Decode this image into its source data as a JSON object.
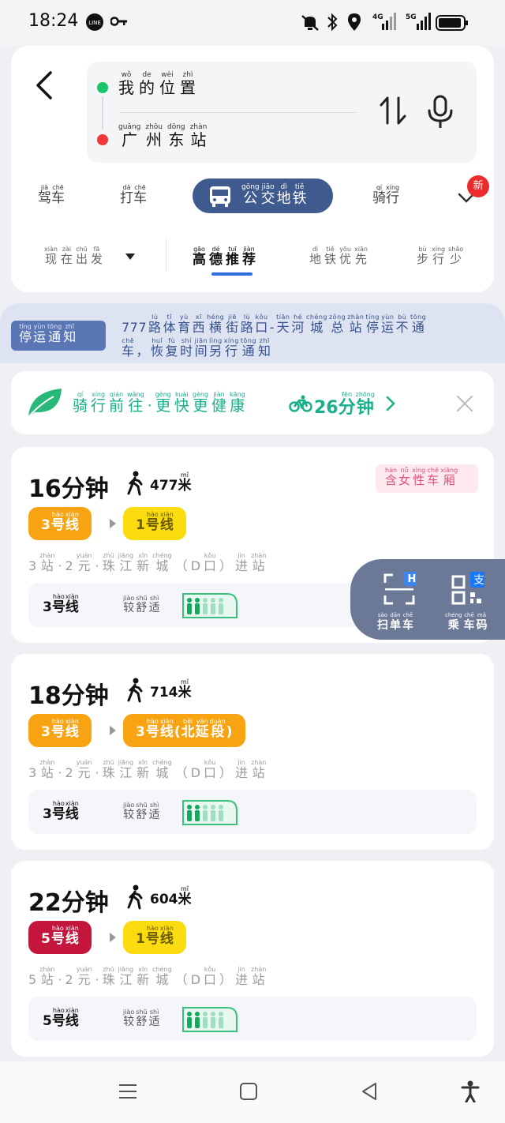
{
  "status_bar": {
    "time": "18:24",
    "icons": [
      "line-icon",
      "key-icon",
      "mute-icon",
      "bluetooth-icon",
      "location-icon",
      "4g-signal-icon",
      "5g-signal-icon",
      "battery-icon"
    ],
    "net1": "4G",
    "net2": "5G"
  },
  "route": {
    "origin": [
      {
        "py": "wǒ",
        "hz": "我"
      },
      {
        "py": "de",
        "hz": "的"
      },
      {
        "py": "wèi",
        "hz": "位"
      },
      {
        "py": "zhì",
        "hz": "置"
      }
    ],
    "destination": [
      {
        "py": "guǎng",
        "hz": "广"
      },
      {
        "py": "zhōu",
        "hz": "州"
      },
      {
        "py": "dōng",
        "hz": "东"
      },
      {
        "py": "zhàn",
        "hz": "站"
      }
    ]
  },
  "modes": [
    [
      {
        "py": "jià",
        "hz": "驾"
      },
      {
        "py": "chē",
        "hz": "车"
      }
    ],
    [
      {
        "py": "dǎ",
        "hz": "打"
      },
      {
        "py": "chē",
        "hz": "车"
      }
    ],
    [
      {
        "py": "gōng",
        "hz": "公"
      },
      {
        "py": "jiāo",
        "hz": "交"
      },
      {
        "py": "dì",
        "hz": "地"
      },
      {
        "py": "tiě",
        "hz": "铁"
      }
    ],
    [
      {
        "py": "qí",
        "hz": "骑"
      },
      {
        "py": "xíng",
        "hz": "行"
      }
    ]
  ],
  "new_badge": "新",
  "sort": {
    "time_filter": [
      {
        "py": "xiàn",
        "hz": "现"
      },
      {
        "py": "zài",
        "hz": "在"
      },
      {
        "py": "chū",
        "hz": "出"
      },
      {
        "py": "fā",
        "hz": "发"
      }
    ],
    "options": [
      [
        {
          "py": "gāo",
          "hz": "高"
        },
        {
          "py": "dé",
          "hz": "德"
        },
        {
          "py": "tuī",
          "hz": "推"
        },
        {
          "py": "jiàn",
          "hz": "荐"
        }
      ],
      [
        {
          "py": "dì",
          "hz": "地"
        },
        {
          "py": "tiě",
          "hz": "铁"
        },
        {
          "py": "yōu",
          "hz": "优"
        },
        {
          "py": "xiān",
          "hz": "先"
        }
      ],
      [
        {
          "py": "bù",
          "hz": "步"
        },
        {
          "py": "xíng",
          "hz": "行"
        },
        {
          "py": "shǎo",
          "hz": "少"
        }
      ]
    ]
  },
  "notice": {
    "tag": [
      {
        "py": "tíng",
        "hz": "停"
      },
      {
        "py": "yùn",
        "hz": "运"
      },
      {
        "py": "tōng",
        "hz": "通"
      },
      {
        "py": "zhī",
        "hz": "知"
      }
    ],
    "line1": [
      {
        "py": "",
        "hz": "777"
      },
      {
        "py": "lù",
        "hz": "路"
      },
      {
        "py": "tǐ",
        "hz": "体"
      },
      {
        "py": "yù",
        "hz": "育"
      },
      {
        "py": "xī",
        "hz": "西"
      },
      {
        "py": "héng",
        "hz": "横"
      },
      {
        "py": "jiē",
        "hz": "街"
      },
      {
        "py": "lù",
        "hz": "路"
      },
      {
        "py": "kǒu",
        "hz": "口"
      },
      {
        "py": "",
        "hz": "-"
      },
      {
        "py": "tiān",
        "hz": "天"
      },
      {
        "py": "hé",
        "hz": "河"
      },
      {
        "py": "chéng",
        "hz": "城"
      },
      {
        "py": "zǒng",
        "hz": "总"
      },
      {
        "py": "zhàn",
        "hz": "站"
      },
      {
        "py": "tíng",
        "hz": "停"
      },
      {
        "py": "yùn",
        "hz": "运"
      },
      {
        "py": "bù",
        "hz": "不"
      },
      {
        "py": "tōng",
        "hz": "通"
      }
    ],
    "line2": [
      {
        "py": "chē",
        "hz": "车"
      },
      {
        "py": "",
        "hz": "，"
      },
      {
        "py": "huī",
        "hz": "恢"
      },
      {
        "py": "fù",
        "hz": "复"
      },
      {
        "py": "shí",
        "hz": "时"
      },
      {
        "py": "jiān",
        "hz": "间"
      },
      {
        "py": "lìng",
        "hz": "另"
      },
      {
        "py": "xíng",
        "hz": "行"
      },
      {
        "py": "tōng",
        "hz": "通"
      },
      {
        "py": "zhī",
        "hz": "知"
      }
    ]
  },
  "bike": {
    "text": [
      {
        "py": "qí",
        "hz": "骑"
      },
      {
        "py": "xíng",
        "hz": "行"
      },
      {
        "py": "qián",
        "hz": "前"
      },
      {
        "py": "wǎng",
        "hz": "往"
      },
      {
        "py": "",
        "hz": "·"
      },
      {
        "py": "gèng",
        "hz": "更"
      },
      {
        "py": "kuài",
        "hz": "快"
      },
      {
        "py": "gèng",
        "hz": "更"
      },
      {
        "py": "jiàn",
        "hz": "健"
      },
      {
        "py": "kāng",
        "hz": "康"
      }
    ],
    "minutes": [
      {
        "py": "",
        "hz": "26"
      },
      {
        "py": "fēn",
        "hz": "分"
      },
      {
        "py": "zhōng",
        "hz": "钟"
      }
    ]
  },
  "routes": [
    {
      "duration": "16分钟",
      "walk": [
        {
          "py": "",
          "hz": "477"
        },
        {
          "py": "mǐ",
          "hz": "米"
        }
      ],
      "lines": [
        {
          "color": "orange",
          "label": [
            {
              "py": "",
              "hz": "3"
            },
            {
              "py": "hào",
              "hz": "号"
            },
            {
              "py": "xiàn",
              "hz": "线"
            }
          ]
        },
        {
          "color": "yellow",
          "label": [
            {
              "py": "",
              "hz": "1"
            },
            {
              "py": "hào",
              "hz": "号"
            },
            {
              "py": "xiàn",
              "hz": "线"
            }
          ]
        }
      ],
      "info": [
        {
          "py": "",
          "hz": "3"
        },
        {
          "py": "zhàn",
          "hz": "站"
        },
        {
          "py": "",
          "hz": "·"
        },
        {
          "py": "",
          "hz": "2"
        },
        {
          "py": "yuán",
          "hz": "元"
        },
        {
          "py": "",
          "hz": "·"
        },
        {
          "py": "zhū",
          "hz": "珠"
        },
        {
          "py": "jiāng",
          "hz": "江"
        },
        {
          "py": "xīn",
          "hz": "新"
        },
        {
          "py": "chéng",
          "hz": "城"
        },
        {
          "py": "",
          "hz": "（"
        },
        {
          "py": "",
          "hz": "D"
        },
        {
          "py": "kǒu",
          "hz": "口"
        },
        {
          "py": "",
          "hz": "）"
        },
        {
          "py": "jìn",
          "hz": "进"
        },
        {
          "py": "zhàn",
          "hz": "站"
        }
      ],
      "crowd_line": [
        {
          "py": "",
          "hz": "3"
        },
        {
          "py": "hào",
          "hz": "号"
        },
        {
          "py": "xiàn",
          "hz": "线"
        }
      ],
      "crowd_level": [
        {
          "py": "jiào",
          "hz": "较"
        },
        {
          "py": "shū",
          "hz": "舒"
        },
        {
          "py": "shì",
          "hz": "适"
        }
      ],
      "female_tag": [
        {
          "py": "hán",
          "hz": "含"
        },
        {
          "py": "nǚ",
          "hz": "女"
        },
        {
          "py": "xìng",
          "hz": "性"
        },
        {
          "py": "chē",
          "hz": "车"
        },
        {
          "py": "xiāng",
          "hz": "厢"
        }
      ]
    },
    {
      "duration": "18分钟",
      "walk": [
        {
          "py": "",
          "hz": "714"
        },
        {
          "py": "mǐ",
          "hz": "米"
        }
      ],
      "lines": [
        {
          "color": "orange",
          "label": [
            {
              "py": "",
              "hz": "3"
            },
            {
              "py": "hào",
              "hz": "号"
            },
            {
              "py": "xiàn",
              "hz": "线"
            }
          ]
        },
        {
          "color": "orange",
          "label": [
            {
              "py": "",
              "hz": "3"
            },
            {
              "py": "hào",
              "hz": "号"
            },
            {
              "py": "xiàn",
              "hz": "线"
            },
            {
              "py": "",
              "hz": "("
            },
            {
              "py": "běi",
              "hz": "北"
            },
            {
              "py": "yán",
              "hz": "延"
            },
            {
              "py": "duàn",
              "hz": "段"
            },
            {
              "py": "",
              "hz": ")"
            }
          ]
        }
      ],
      "info": [
        {
          "py": "",
          "hz": "3"
        },
        {
          "py": "zhàn",
          "hz": "站"
        },
        {
          "py": "",
          "hz": "·"
        },
        {
          "py": "",
          "hz": "2"
        },
        {
          "py": "yuán",
          "hz": "元"
        },
        {
          "py": "",
          "hz": "·"
        },
        {
          "py": "zhū",
          "hz": "珠"
        },
        {
          "py": "jiāng",
          "hz": "江"
        },
        {
          "py": "xīn",
          "hz": "新"
        },
        {
          "py": "chéng",
          "hz": "城"
        },
        {
          "py": "",
          "hz": "（"
        },
        {
          "py": "",
          "hz": "D"
        },
        {
          "py": "kǒu",
          "hz": "口"
        },
        {
          "py": "",
          "hz": "）"
        },
        {
          "py": "jìn",
          "hz": "进"
        },
        {
          "py": "zhàn",
          "hz": "站"
        }
      ],
      "crowd_line": [
        {
          "py": "",
          "hz": "3"
        },
        {
          "py": "hào",
          "hz": "号"
        },
        {
          "py": "xiàn",
          "hz": "线"
        }
      ],
      "crowd_level": [
        {
          "py": "jiào",
          "hz": "较"
        },
        {
          "py": "shū",
          "hz": "舒"
        },
        {
          "py": "shì",
          "hz": "适"
        }
      ]
    },
    {
      "duration": "22分钟",
      "walk": [
        {
          "py": "",
          "hz": "604"
        },
        {
          "py": "mǐ",
          "hz": "米"
        }
      ],
      "lines": [
        {
          "color": "crimson",
          "label": [
            {
              "py": "",
              "hz": "5"
            },
            {
              "py": "hào",
              "hz": "号"
            },
            {
              "py": "xiàn",
              "hz": "线"
            }
          ]
        },
        {
          "color": "yellow",
          "label": [
            {
              "py": "",
              "hz": "1"
            },
            {
              "py": "hào",
              "hz": "号"
            },
            {
              "py": "xiàn",
              "hz": "线"
            }
          ]
        }
      ],
      "info": [
        {
          "py": "",
          "hz": "5"
        },
        {
          "py": "zhàn",
          "hz": "站"
        },
        {
          "py": "",
          "hz": "·"
        },
        {
          "py": "",
          "hz": "2"
        },
        {
          "py": "yuán",
          "hz": "元"
        },
        {
          "py": "",
          "hz": "·"
        },
        {
          "py": "zhū",
          "hz": "珠"
        },
        {
          "py": "jiāng",
          "hz": "江"
        },
        {
          "py": "xīn",
          "hz": "新"
        },
        {
          "py": "chéng",
          "hz": "城"
        },
        {
          "py": "",
          "hz": "（"
        },
        {
          "py": "",
          "hz": "D"
        },
        {
          "py": "kǒu",
          "hz": "口"
        },
        {
          "py": "",
          "hz": "）"
        },
        {
          "py": "jìn",
          "hz": "进"
        },
        {
          "py": "zhàn",
          "hz": "站"
        }
      ],
      "crowd_line": [
        {
          "py": "",
          "hz": "5"
        },
        {
          "py": "hào",
          "hz": "号"
        },
        {
          "py": "xiàn",
          "hz": "线"
        }
      ],
      "crowd_level": [
        {
          "py": "jiào",
          "hz": "较"
        },
        {
          "py": "shū",
          "hz": "舒"
        },
        {
          "py": "shì",
          "hz": "适"
        }
      ]
    }
  ],
  "floating": {
    "scan": [
      {
        "py": "sǎo",
        "hz": "扫"
      },
      {
        "py": "dān",
        "hz": "单"
      },
      {
        "py": "chē",
        "hz": "车"
      }
    ],
    "ride_code": [
      {
        "py": "chéng",
        "hz": "乘"
      },
      {
        "py": "chē",
        "hz": "车"
      },
      {
        "py": "mǎ",
        "hz": "码"
      }
    ],
    "scan_badge": "H",
    "pay_badge": "支"
  },
  "colors": {
    "accent": "#3f5a8f",
    "line_orange": "#f7a312",
    "line_yellow": "#fbdc10",
    "line_crimson": "#c4153c",
    "bike_green": "#17b08a"
  }
}
